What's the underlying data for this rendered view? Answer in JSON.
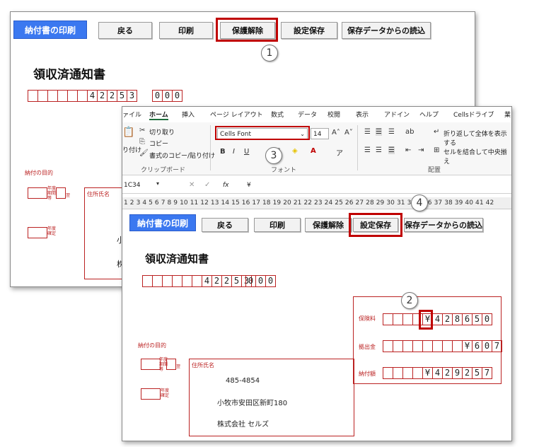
{
  "toolbar": {
    "print_form": "納付書の印刷",
    "back": "戻る",
    "print": "印刷",
    "unprotect": "保護解除",
    "save_settings": "設定保存",
    "load_saved": "保存データからの読込"
  },
  "callouts": {
    "c1": "1",
    "c2": "2",
    "c3": "3",
    "c4": "4"
  },
  "doc": {
    "title": "領収済通知書",
    "num_row1": [
      "",
      "",
      "",
      "",
      "",
      "",
      "4",
      "2",
      "2",
      "5",
      "3"
    ],
    "num_row2": [
      "0",
      "0",
      "0"
    ],
    "purpose_label": "納付の目的",
    "year_label1": "年度 期間 等",
    "year_suffix": "翌",
    "year_label2": "年度 確定",
    "addr_name_label": "住所氏名",
    "postal": "485-4854",
    "address": "小牧市安田区新町180",
    "company": "株式会社 セルズ",
    "back_addr_partial_1": "小",
    "back_addr_partial_2": "株",
    "hoken_label": "保険料",
    "hoken_digits": [
      "",
      "",
      "",
      "",
      "¥",
      "4",
      "2",
      "8",
      "6",
      "5",
      "0"
    ],
    "keiryo_label": "拠出金",
    "keiryo_digits": [
      "",
      "",
      "",
      "",
      "",
      "",
      "",
      "",
      "¥",
      "6",
      "0",
      "7"
    ],
    "nofu_label": "納付額",
    "nofu_digits": [
      "",
      "",
      "",
      "",
      "¥",
      "4",
      "2",
      "9",
      "2",
      "5",
      "7"
    ]
  },
  "ribbon": {
    "tabs": [
      "ァイル",
      "ホーム",
      "挿入",
      "ページ レイアウト",
      "数式",
      "データ",
      "校閲",
      "表示",
      "アドイン",
      "ヘルプ",
      "Cellsドライブ",
      "業"
    ],
    "active_tab": "ホーム",
    "cut": "切り取り",
    "copy": "コピー",
    "paste_partial": "り付け",
    "format_painter": "書式のコピー/貼り付け",
    "clipboard_group": "クリップボード",
    "font_name": "Cells Font",
    "font_size": "14",
    "font_group": "フォント",
    "wrap_text": "折り返して全体を表示する",
    "merge_center": "セルを結合して中央揃え",
    "align_group": "配置",
    "name_box": "1C34",
    "formula_value": "¥",
    "fx": "fx",
    "columns_header": "1 2 3 4 5 6 7 8 9 10 11 12 13 14 15 16 17 18 19 20 21 22 23 24 25 26 27 28 29 30 31 3    35 36 37 38 39 40 41 42"
  }
}
